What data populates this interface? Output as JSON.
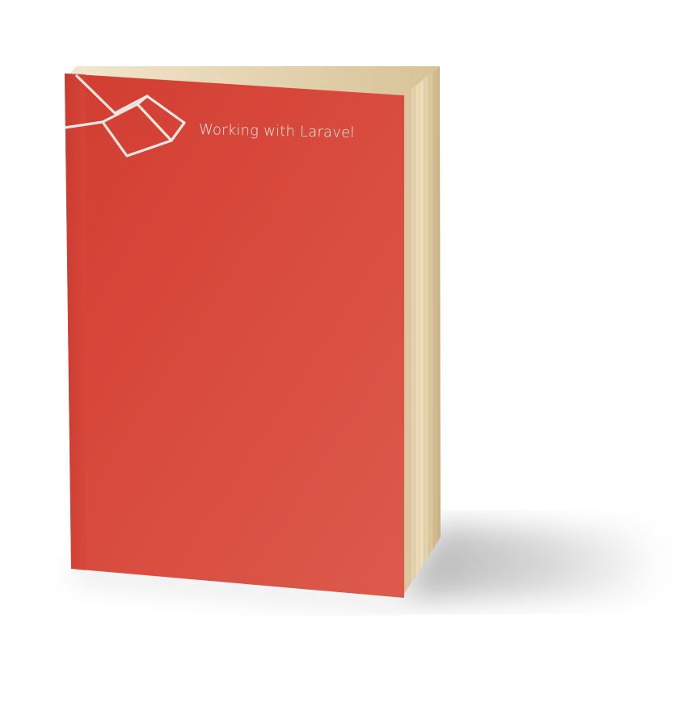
{
  "book": {
    "title": "Working with Laravel",
    "logo": "laravel-logo",
    "cover_color": "#d94b3d",
    "page_color": "#e9d9b8"
  }
}
